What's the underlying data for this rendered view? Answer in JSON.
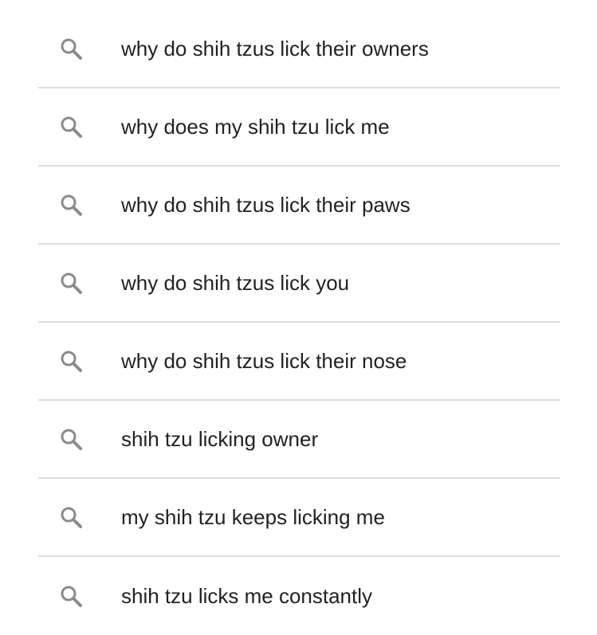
{
  "suggestions": {
    "items": [
      {
        "label": "why do shih tzus lick their owners",
        "icon": "search-icon"
      },
      {
        "label": "why does my shih tzu lick me",
        "icon": "search-icon"
      },
      {
        "label": "why do shih tzus lick their paws",
        "icon": "search-icon"
      },
      {
        "label": "why do shih tzus lick you",
        "icon": "search-icon"
      },
      {
        "label": "why do shih tzus lick their nose",
        "icon": "search-icon"
      },
      {
        "label": "shih tzu licking owner",
        "icon": "search-icon"
      },
      {
        "label": "my shih tzu keeps licking me",
        "icon": "search-icon"
      },
      {
        "label": "shih tzu licks me constantly",
        "icon": "search-icon"
      }
    ],
    "colors": {
      "text": "#222222",
      "icon": "#8a8a8a",
      "divider": "#dddddd",
      "background": "#ffffff"
    }
  }
}
